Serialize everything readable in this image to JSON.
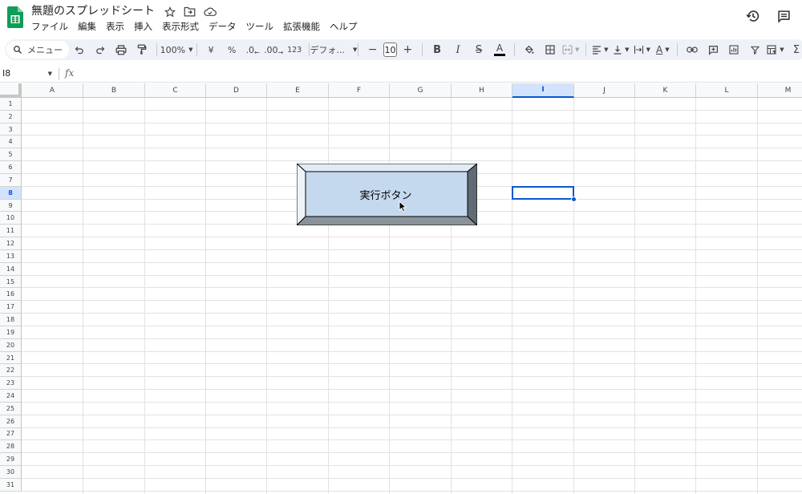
{
  "app": {
    "title": "無題のスプレッドシート"
  },
  "menu": [
    "ファイル",
    "編集",
    "表示",
    "挿入",
    "表示形式",
    "データ",
    "ツール",
    "拡張機能",
    "ヘルプ"
  ],
  "toolbar": {
    "search_label": "メニュー",
    "zoom": "100%",
    "currency": "¥",
    "percent": "%",
    "decrease_decimal": ".0",
    "increase_decimal": ".00",
    "number_format": "123",
    "font": "デフォ...",
    "font_size": "10",
    "bold": "B",
    "italic": "I",
    "strikethrough": "S",
    "text_color": "A",
    "text_color_hex": "#000000",
    "rotate": "A",
    "sum": "Σ"
  },
  "formula_bar": {
    "name_box": "I8",
    "fx": "fx",
    "value": ""
  },
  "grid": {
    "columns": [
      "A",
      "B",
      "C",
      "D",
      "E",
      "F",
      "G",
      "H",
      "I",
      "J",
      "K",
      "L",
      "M"
    ],
    "rows": [
      "1",
      "2",
      "3",
      "4",
      "5",
      "6",
      "7",
      "8",
      "9",
      "10",
      "11",
      "12",
      "13",
      "14",
      "15",
      "16",
      "17",
      "18",
      "19",
      "20",
      "21",
      "22",
      "23",
      "24",
      "25",
      "26",
      "27",
      "28",
      "29",
      "30",
      "31"
    ],
    "selected_cell": "I8",
    "selected_column": "I",
    "selected_row": "8"
  },
  "drawing": {
    "label": "実行ボタン",
    "face_color": "#c5d9ee",
    "edge_color": "#606b73"
  },
  "colors": {
    "accent": "#0b57d0",
    "sheets_green": "#0f9d58"
  }
}
